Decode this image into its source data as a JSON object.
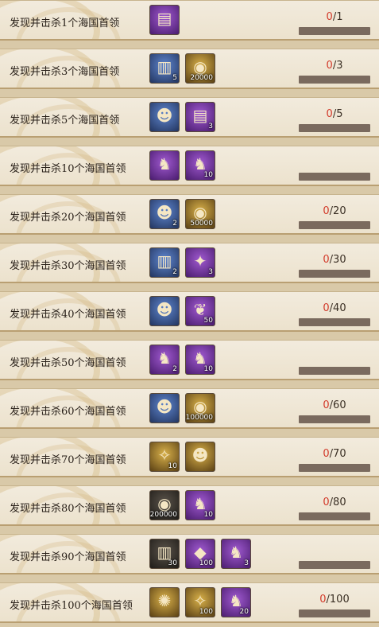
{
  "rows": [
    {
      "title": "发现并击杀1个海国首领",
      "progress_current": "0",
      "progress_total": "/1",
      "rewards": [
        {
          "icon": "spell-card-icon",
          "glyph": "▤",
          "style": "r-purple",
          "qty": ""
        }
      ]
    },
    {
      "title": "发现并击杀3个海国首领",
      "progress_current": "0",
      "progress_total": "/3",
      "rewards": [
        {
          "icon": "scroll-icon",
          "glyph": "▥",
          "style": "r-blue",
          "qty": "5"
        },
        {
          "icon": "gold-coin-icon",
          "glyph": "◉",
          "style": "r-gold",
          "qty": "20000"
        }
      ]
    },
    {
      "title": "发现并击杀5个海国首领",
      "progress_current": "0",
      "progress_total": "/5",
      "rewards": [
        {
          "icon": "daruma-icon",
          "glyph": "☻",
          "style": "r-blue",
          "qty": ""
        },
        {
          "icon": "spell-card-icon",
          "glyph": "▤",
          "style": "r-purple",
          "qty": "3"
        }
      ]
    },
    {
      "title": "发现并击杀10个海国首领",
      "progress_current": "",
      "progress_total": "",
      "rewards": [
        {
          "icon": "shikigami-icon",
          "glyph": "♞",
          "style": "r-purple",
          "qty": ""
        },
        {
          "icon": "shikigami-icon",
          "glyph": "♞",
          "style": "r-purple",
          "qty": "10"
        }
      ]
    },
    {
      "title": "发现并击杀20个海国首领",
      "progress_current": "0",
      "progress_total": "/20",
      "rewards": [
        {
          "icon": "daruma-icon",
          "glyph": "☻",
          "style": "r-blue",
          "qty": "2"
        },
        {
          "icon": "gold-coin-icon",
          "glyph": "◉",
          "style": "r-gold",
          "qty": "50000"
        }
      ]
    },
    {
      "title": "发现并击杀30个海国首领",
      "progress_current": "0",
      "progress_total": "/30",
      "rewards": [
        {
          "icon": "scroll-icon",
          "glyph": "▥",
          "style": "r-blue",
          "qty": "2"
        },
        {
          "icon": "demon-mask-icon",
          "glyph": "✦",
          "style": "r-purple",
          "qty": "3"
        }
      ]
    },
    {
      "title": "发现并击杀40个海国首领",
      "progress_current": "0",
      "progress_total": "/40",
      "rewards": [
        {
          "icon": "daruma-icon",
          "glyph": "☻",
          "style": "r-blue",
          "qty": ""
        },
        {
          "icon": "red-soul-icon",
          "glyph": "❦",
          "style": "r-purple",
          "qty": "50"
        }
      ]
    },
    {
      "title": "发现并击杀50个海国首领",
      "progress_current": "",
      "progress_total": "",
      "rewards": [
        {
          "icon": "shikigami-icon",
          "glyph": "♞",
          "style": "r-purple",
          "qty": "2"
        },
        {
          "icon": "shikigami-icon",
          "glyph": "♞",
          "style": "r-purple",
          "qty": "10"
        }
      ]
    },
    {
      "title": "发现并击杀60个海国首领",
      "progress_current": "0",
      "progress_total": "/60",
      "rewards": [
        {
          "icon": "daruma-icon",
          "glyph": "☻",
          "style": "r-blue",
          "qty": ""
        },
        {
          "icon": "gold-coin-icon",
          "glyph": "◉",
          "style": "r-gold",
          "qty": "100000"
        }
      ]
    },
    {
      "title": "发现并击杀70个海国首领",
      "progress_current": "0",
      "progress_total": "/70",
      "rewards": [
        {
          "icon": "equipment-icon",
          "glyph": "✧",
          "style": "r-gold",
          "qty": "10"
        },
        {
          "icon": "daruma-icon",
          "glyph": "☻",
          "style": "r-gold",
          "qty": ""
        }
      ]
    },
    {
      "title": "发现并击杀80个海国首领",
      "progress_current": "0",
      "progress_total": "/80",
      "rewards": [
        {
          "icon": "gold-coin-icon",
          "glyph": "◉",
          "style": "r-dark",
          "qty": "200000"
        },
        {
          "icon": "shikigami-icon",
          "glyph": "♞",
          "style": "r-purple",
          "qty": "10"
        }
      ]
    },
    {
      "title": "发现并击杀90个海国首领",
      "progress_current": "",
      "progress_total": "",
      "rewards": [
        {
          "icon": "scroll-bundle-icon",
          "glyph": "▥",
          "style": "r-dark",
          "qty": "30"
        },
        {
          "icon": "purple-gem-icon",
          "glyph": "◆",
          "style": "r-purple",
          "qty": "100"
        },
        {
          "icon": "shikigami-icon",
          "glyph": "♞",
          "style": "r-purple",
          "qty": "3"
        }
      ]
    },
    {
      "title": "发现并击杀100个海国首领",
      "progress_current": "0",
      "progress_total": "/100",
      "rewards": [
        {
          "icon": "golden-orb-icon",
          "glyph": "✺",
          "style": "r-gold",
          "qty": ""
        },
        {
          "icon": "equipment-icon",
          "glyph": "✧",
          "style": "r-gold",
          "qty": "100"
        },
        {
          "icon": "shikigami-icon",
          "glyph": "♞",
          "style": "r-purple",
          "qty": "20"
        }
      ]
    }
  ]
}
